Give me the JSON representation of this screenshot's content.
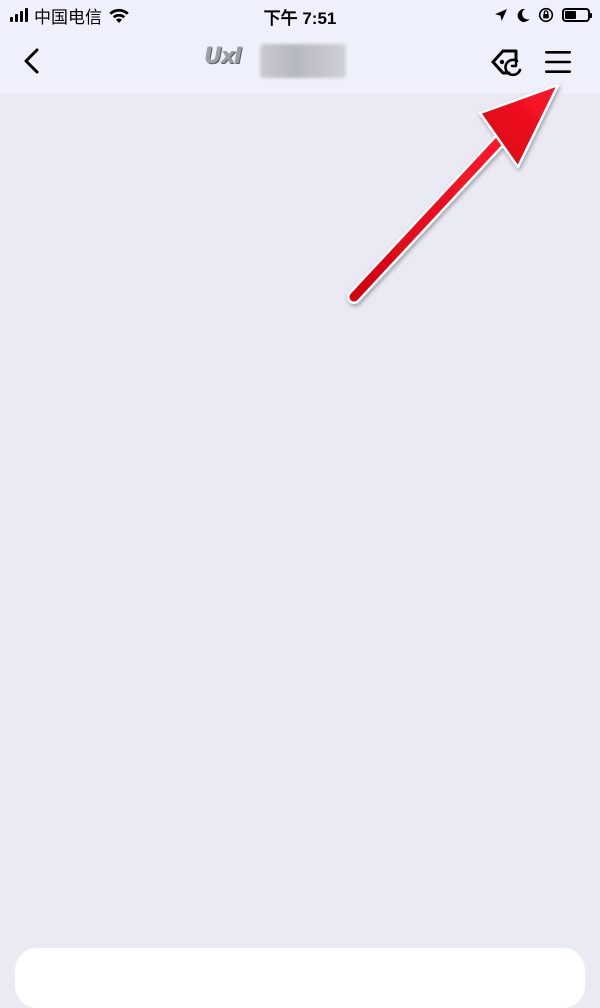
{
  "status_bar": {
    "carrier": "中国电信",
    "time": "下午 7:51",
    "icons": [
      "signal-icon",
      "wifi-icon",
      "location-icon",
      "moon-icon",
      "orientation-lock-icon",
      "battery-icon"
    ],
    "battery_level": 0.5
  },
  "nav_bar": {
    "logo_text": "UxI",
    "icons": [
      "back-icon",
      "share-icon",
      "menu-icon"
    ]
  },
  "colors": {
    "page_background": "#e9eaf3",
    "bar_background": "#eef0fb",
    "annotation_arrow": "#e5001a"
  }
}
